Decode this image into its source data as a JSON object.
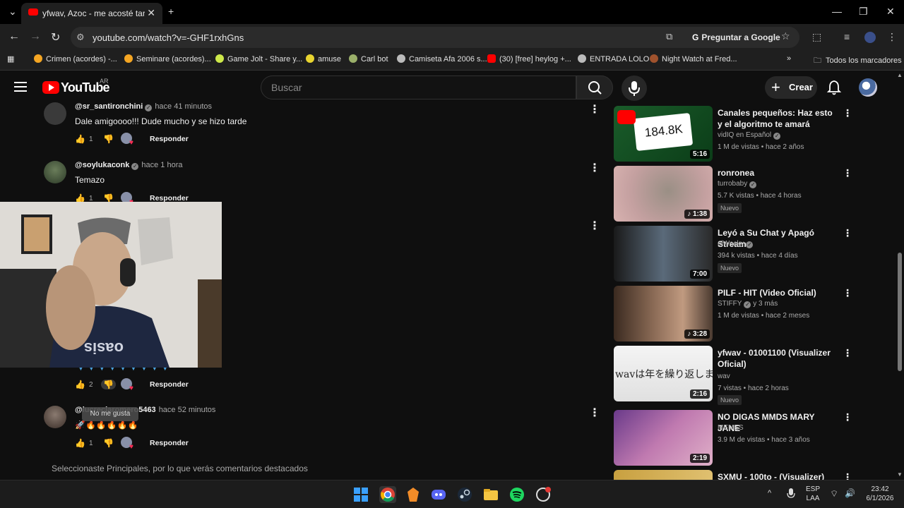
{
  "browser": {
    "tab_title": "yfwav, Azoc - me acosté tarde",
    "url": "youtube.com/watch?v=-GHF1rxhGns",
    "ask_google": "Preguntar a Google",
    "bookmarks": [
      "Crimen (acordes) -...",
      "Seminare (acordes)...",
      "Game Jolt - Share y...",
      "amuse",
      "Carl bot",
      "Camiseta Afa 2006 s...",
      "(30) [free] heylog +...",
      "ENTRADA LOLO",
      "Night Watch at Fred..."
    ],
    "all_bookmarks": "Todos los marcadores"
  },
  "youtube": {
    "logo_text": "YouTube",
    "country": "AR",
    "search_placeholder": "Buscar",
    "create_label": "Crear"
  },
  "comments": [
    {
      "author": "@sr_santironchini",
      "time": "hace 41 minutos",
      "text": "Dale amigoooo!!! Dude mucho y se hizo tarde",
      "likes": "1",
      "reply": "Responder"
    },
    {
      "author": "@soylukaconk",
      "time": "hace 1 hora",
      "text": "Temazo",
      "likes": "1",
      "reply": "Responder"
    },
    {
      "author": "",
      "time": "",
      "text": "",
      "likes": "2",
      "reply": "Responder"
    },
    {
      "author": "@lucreciaromero5463",
      "time": "hace 52 minutos",
      "text": "🚀🔥🔥🔥🔥🔥",
      "likes": "1",
      "reply": "Responder"
    }
  ],
  "tooltip": "No me gusta",
  "footer_note": "Seleccionaste Principales, por lo que verás comentarios destacados",
  "sidebar": [
    {
      "title": "Canales pequeños: Haz esto y el algoritmo te amará",
      "channel": "vidIQ en Español",
      "meta": "1 M de vistas • hace 2 años",
      "duration": "5:16",
      "badge": "",
      "thumb_text": "184.8K"
    },
    {
      "title": "ronronea",
      "channel": "turrobaby",
      "meta": "5.7 K vistas • hace 4 horas",
      "duration": "1:38",
      "badge": "Nuevo"
    },
    {
      "title": "Leyó a Su Chat y Apagó Stream",
      "channel": "elWacky",
      "meta": "394 k vistas • hace 4 días",
      "duration": "7:00",
      "badge": "Nuevo"
    },
    {
      "title": "PILF - HIT (Video Oficial)",
      "channel": "STIFFY",
      "channel_extra": "y 3 más",
      "meta": "1 M de vistas • hace 2 meses",
      "duration": "3:28",
      "badge": ""
    },
    {
      "title": "yfwav - 01001100 (Visualizer Oficial)",
      "channel": "wav",
      "meta": "7 vistas • hace 2 horas",
      "duration": "2:16",
      "badge": "Nuevo",
      "thumb_text": "wavは年を繰り返しません"
    },
    {
      "title": "NO DIGAS MMDS MARY JANE",
      "channel": "MEMES",
      "meta": "3.9 M de vistas • hace 3 años",
      "duration": "2:19",
      "badge": ""
    },
    {
      "title": "SXMU - 100to - (Visualizer)",
      "channel": "",
      "meta": "",
      "duration": "",
      "badge": ""
    }
  ],
  "taskbar": {
    "lang_top": "ESP",
    "lang_bottom": "LAA",
    "time": "23:42",
    "date": "6/1/2026"
  }
}
